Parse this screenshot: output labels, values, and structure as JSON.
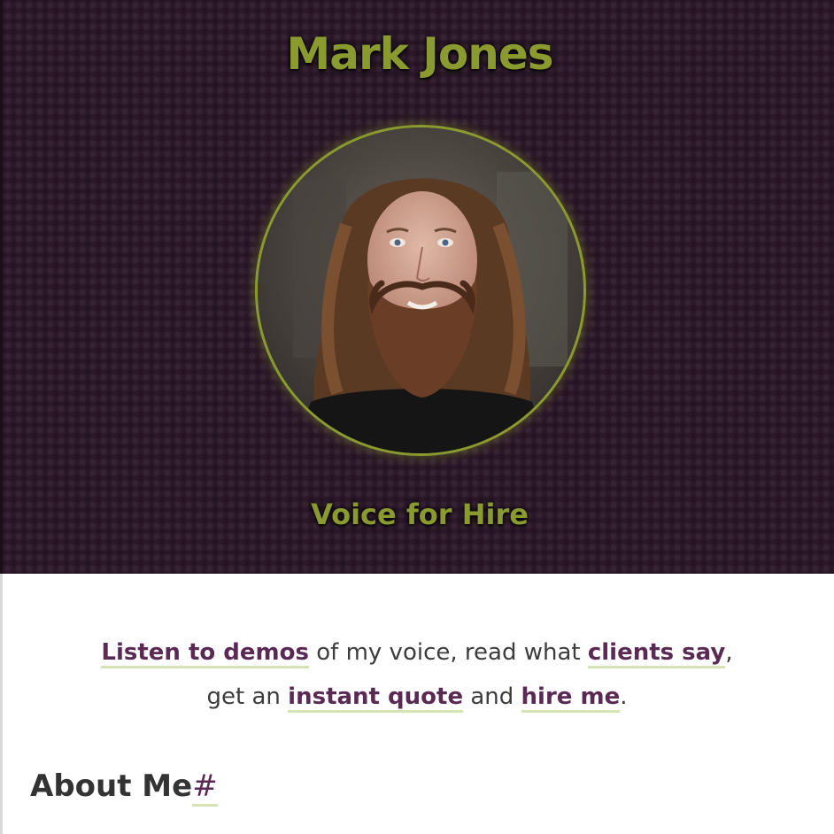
{
  "header": {
    "title": "Mark Jones",
    "subtitle": "Voice for Hire",
    "portrait_alt": "Mark Jones portrait"
  },
  "intro": {
    "link_demos": "Listen to demos",
    "text_1": " of my voice, read what ",
    "link_clients": "clients say",
    "text_2": ",",
    "text_3": "get an ",
    "link_quote": "instant quote",
    "text_4": " and ",
    "link_hire": "hire me",
    "text_5": "."
  },
  "about": {
    "heading": "About Me",
    "anchor": "#"
  },
  "colors": {
    "header_bg": "#2a1728",
    "accent_green": "#8a9a2e",
    "link_purple": "#5a2a55",
    "link_underline": "#d4e2b4"
  }
}
